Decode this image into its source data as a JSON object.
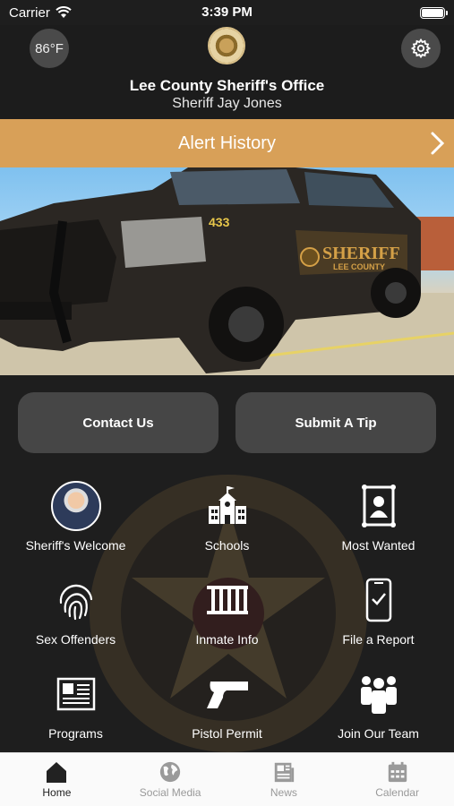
{
  "status": {
    "carrier": "Carrier",
    "time": "3:39 PM"
  },
  "header": {
    "temperature": "86°F",
    "title": "Lee County Sheriff's Office",
    "subtitle": "Sheriff Jay Jones"
  },
  "alert": {
    "label": "Alert History"
  },
  "hero": {
    "vehicle_text": "SHERIFF",
    "vehicle_sub": "LEE COUNTY",
    "unit": "433"
  },
  "actions": {
    "contact": "Contact Us",
    "tip": "Submit A Tip"
  },
  "grid": [
    {
      "label": "Sheriff's Welcome",
      "icon": "sheriff-avatar"
    },
    {
      "label": "Schools",
      "icon": "school-icon"
    },
    {
      "label": "Most Wanted",
      "icon": "most-wanted-icon"
    },
    {
      "label": "Sex Offenders",
      "icon": "fingerprint-icon"
    },
    {
      "label": "Inmate Info",
      "icon": "jail-cell-icon"
    },
    {
      "label": "File a Report",
      "icon": "phone-check-icon"
    },
    {
      "label": "Programs",
      "icon": "newspaper-icon"
    },
    {
      "label": "Pistol Permit",
      "icon": "pistol-icon"
    },
    {
      "label": "Join Our Team",
      "icon": "team-icon"
    }
  ],
  "tabs": [
    {
      "label": "Home",
      "icon": "home-icon",
      "active": true
    },
    {
      "label": "Social Media",
      "icon": "globe-icon",
      "active": false
    },
    {
      "label": "News",
      "icon": "news-icon",
      "active": false
    },
    {
      "label": "Calendar",
      "icon": "calendar-icon",
      "active": false
    }
  ],
  "colors": {
    "accent": "#d8a058",
    "background": "#1e1e1e",
    "button": "#464646"
  }
}
